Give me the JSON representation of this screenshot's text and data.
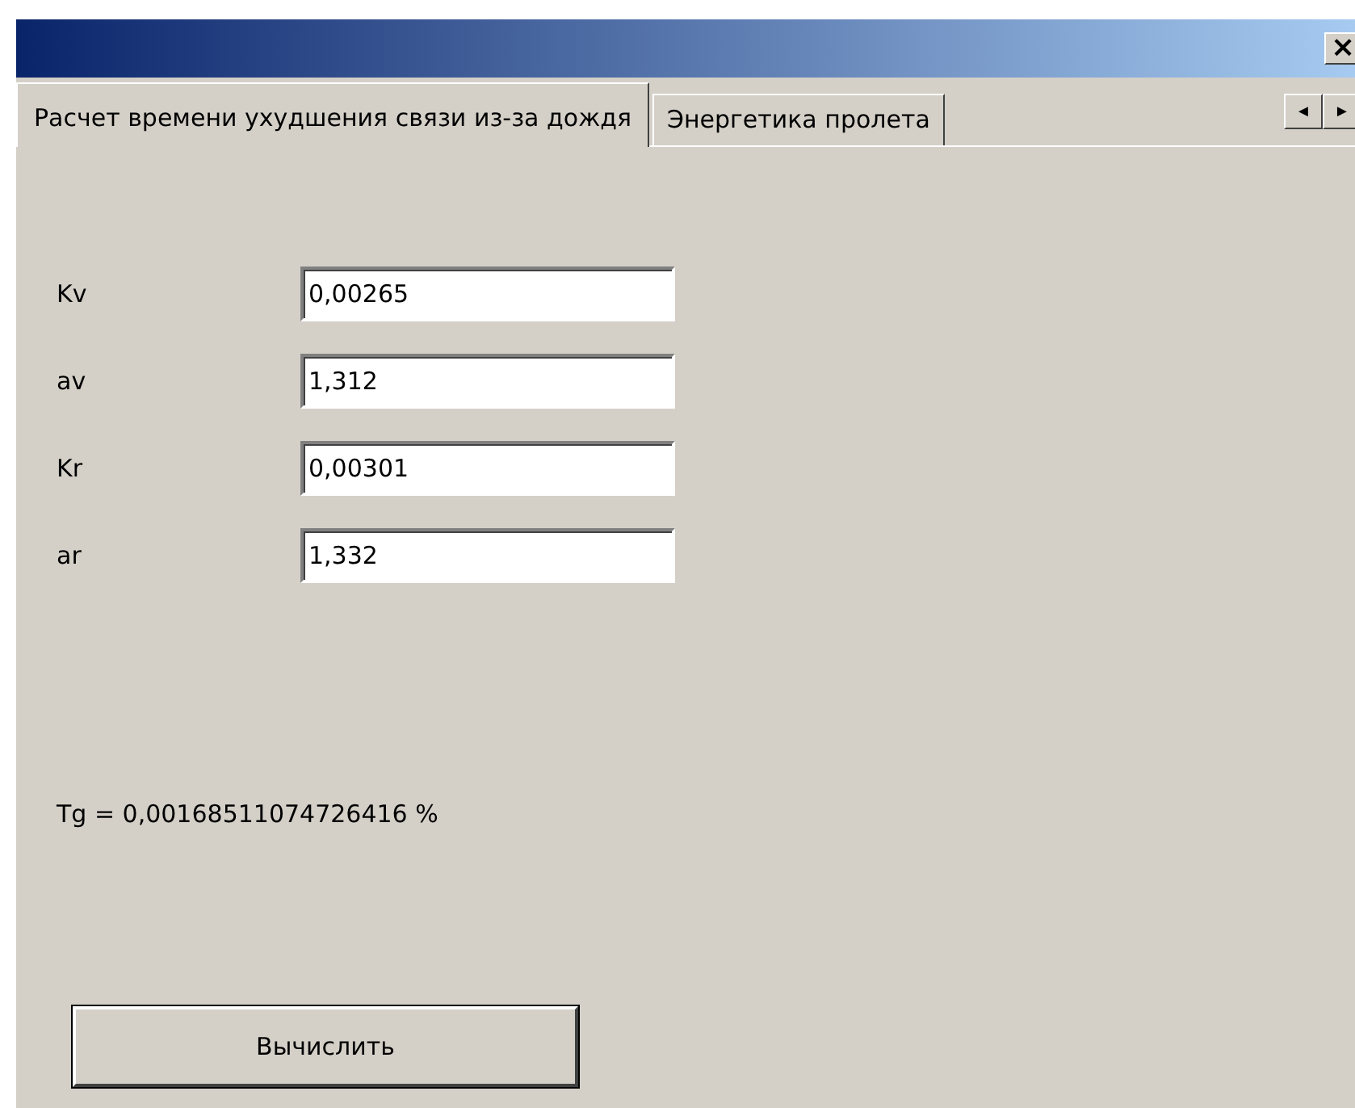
{
  "window": {
    "close_glyph": "×"
  },
  "tabs": [
    {
      "label": "Расчет времени ухудшения связи из-за дождя",
      "selected": true
    },
    {
      "label": "Энергетика пролета",
      "selected": false
    }
  ],
  "tab_scroll": [
    "◄",
    "►"
  ],
  "fields": [
    {
      "label": "Kv",
      "value": "0,00265"
    },
    {
      "label": "av",
      "value": "1,312"
    },
    {
      "label": "Kr",
      "value": "0,00301"
    },
    {
      "label": "ar",
      "value": "1,332"
    }
  ],
  "result": "Tg = 0,00168511074726416 %",
  "button": "Вычислить"
}
